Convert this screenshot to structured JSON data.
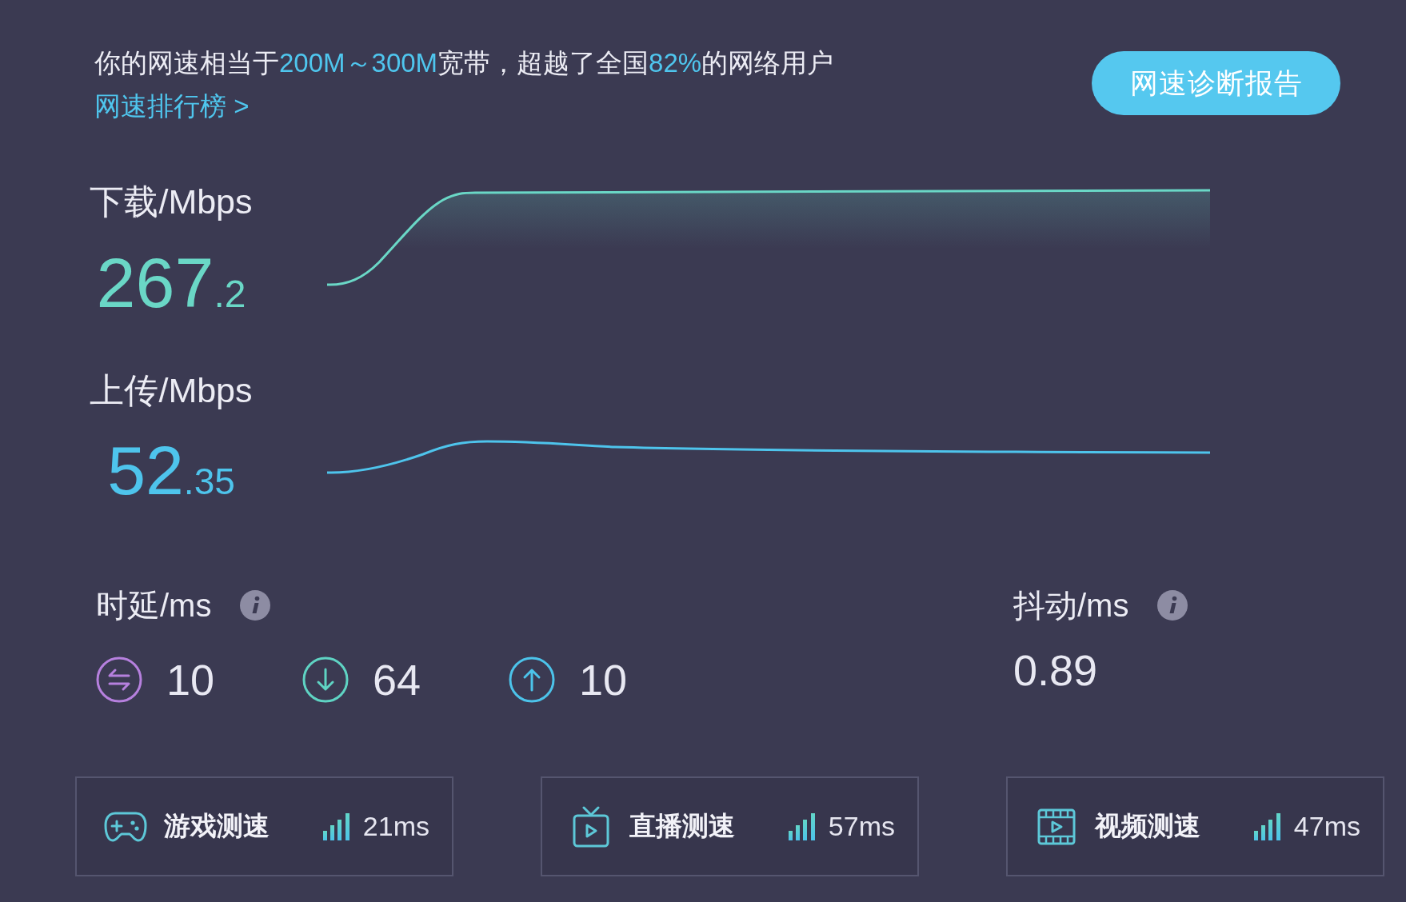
{
  "summary": {
    "segments": [
      {
        "text": "你的网速相当于",
        "highlight": false
      },
      {
        "text": "200M～300M",
        "highlight": true
      },
      {
        "text": "宽带，超越了全国",
        "highlight": false
      },
      {
        "text": "82%",
        "highlight": true
      },
      {
        "text": "的网络用户",
        "highlight": false
      }
    ]
  },
  "ranking_link": "网速排行榜 >",
  "report_button": "网速诊断报告",
  "speeds": [
    {
      "kind": "download",
      "label": "下载/Mbps",
      "whole": "267",
      "decimal": ".2"
    },
    {
      "kind": "upload",
      "label": "上传/Mbps",
      "whole": "52",
      "decimal": ".35"
    }
  ],
  "latency": {
    "label": "时延/ms",
    "items": [
      {
        "kind": "ping",
        "value": "10"
      },
      {
        "kind": "download",
        "value": "64"
      },
      {
        "kind": "upload",
        "value": "10"
      }
    ]
  },
  "jitter": {
    "label": "抖动/ms",
    "value": "0.89"
  },
  "tests": [
    {
      "kind": "game",
      "label": "游戏测速",
      "value": "21ms"
    },
    {
      "kind": "live",
      "label": "直播测速",
      "value": "57ms"
    },
    {
      "kind": "video",
      "label": "视频测速",
      "value": "47ms"
    }
  ]
}
